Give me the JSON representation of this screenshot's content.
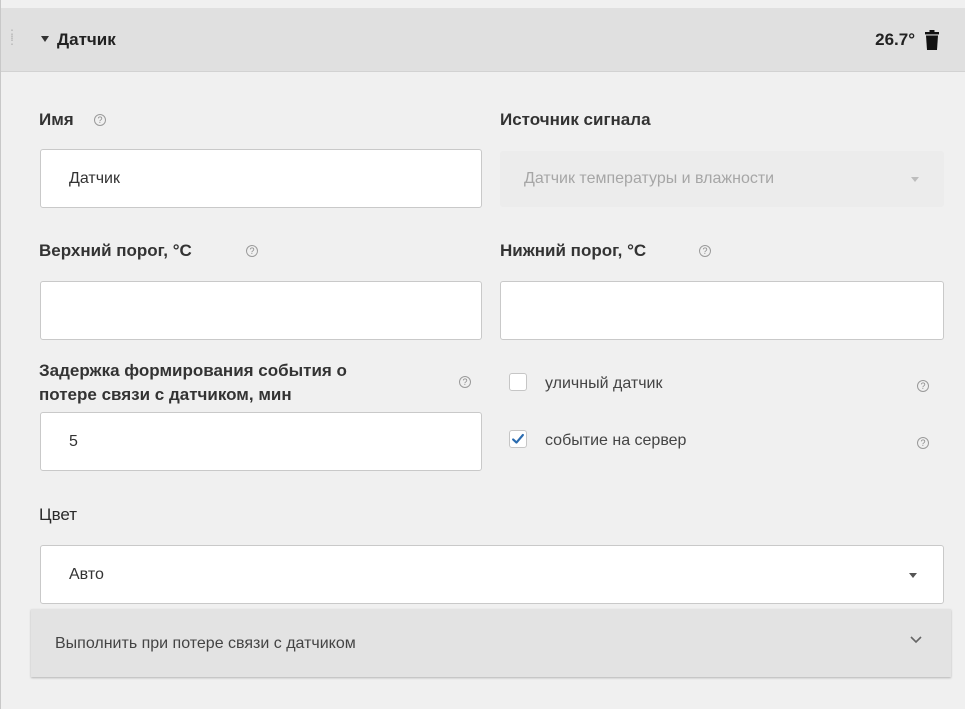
{
  "header": {
    "title": "Датчик",
    "temperature": "26.7°",
    "icons": {
      "collapse": "caret-down-icon",
      "delete": "trash-icon",
      "drag": "drag-handle-icon"
    }
  },
  "form": {
    "name": {
      "label": "Имя",
      "value": "Датчик"
    },
    "source": {
      "label": "Источник сигнала",
      "value": "Датчик температуры и влажности",
      "disabled": true
    },
    "upper_threshold": {
      "label": "Верхний порог, °C",
      "value": ""
    },
    "lower_threshold": {
      "label": "Нижний порог, °C",
      "value": ""
    },
    "delay": {
      "label_line1": "Задержка формирования события о",
      "label_line2": "потере связи с датчиком, мин",
      "value": "5"
    },
    "outdoor_sensor": {
      "label": "уличный датчик",
      "checked": false
    },
    "server_event": {
      "label": "событие на сервер",
      "checked": true
    },
    "color": {
      "label": "Цвет",
      "value": "Авто"
    },
    "help_glyph": "?"
  },
  "section": {
    "on_loss_label": "Выполнить при потере связи с датчиком"
  },
  "colors": {
    "panel_bg": "#f0f0f0",
    "header_bg": "#e0e0e0",
    "check_accent": "#2b6cb0"
  }
}
